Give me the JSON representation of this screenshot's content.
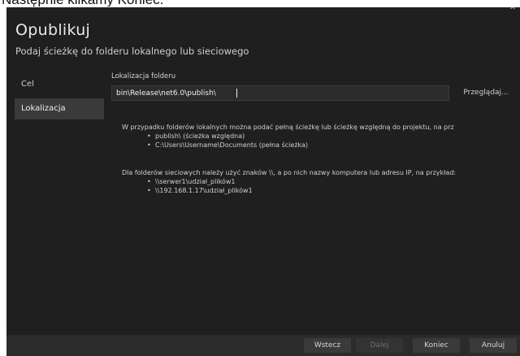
{
  "caption": {
    "text": "Następnie klikamy Koniec."
  },
  "dialog": {
    "title": "Opublikuj",
    "subtitle": "Podaj ścieżkę do folderu lokalnego lub sieciowego"
  },
  "sidebar": {
    "items": [
      {
        "label": "Cel"
      },
      {
        "label": "Lokalizacja"
      }
    ]
  },
  "location": {
    "label": "Lokalizacja folderu",
    "value": "bin\\Release\\net6.0\\publish\\",
    "browse_label": "Przeglądaj...",
    "help": {
      "local_text": "W przypadku folderów lokalnych można podać pełną ścieżkę lub ścieżkę względną do projektu, na prz",
      "local_examples": [
        "publish\\ (ścieżka względna)",
        "C:\\Users\\Username\\Documents (pełna ścieżka)"
      ],
      "network_text": "Dla folderów sieciowych należy użyć znaków \\\\, a po nich nazwy komputera lub adresu IP, na przykład:",
      "network_examples": [
        "\\\\serwer1\\udział_plików1",
        "\\\\192.168.1.17\\udział_plików1"
      ]
    }
  },
  "footer": {
    "back_label": "Wstecz",
    "next_label": "Dalej",
    "finish_label": "Koniec",
    "cancel_label": "Anuluj"
  }
}
